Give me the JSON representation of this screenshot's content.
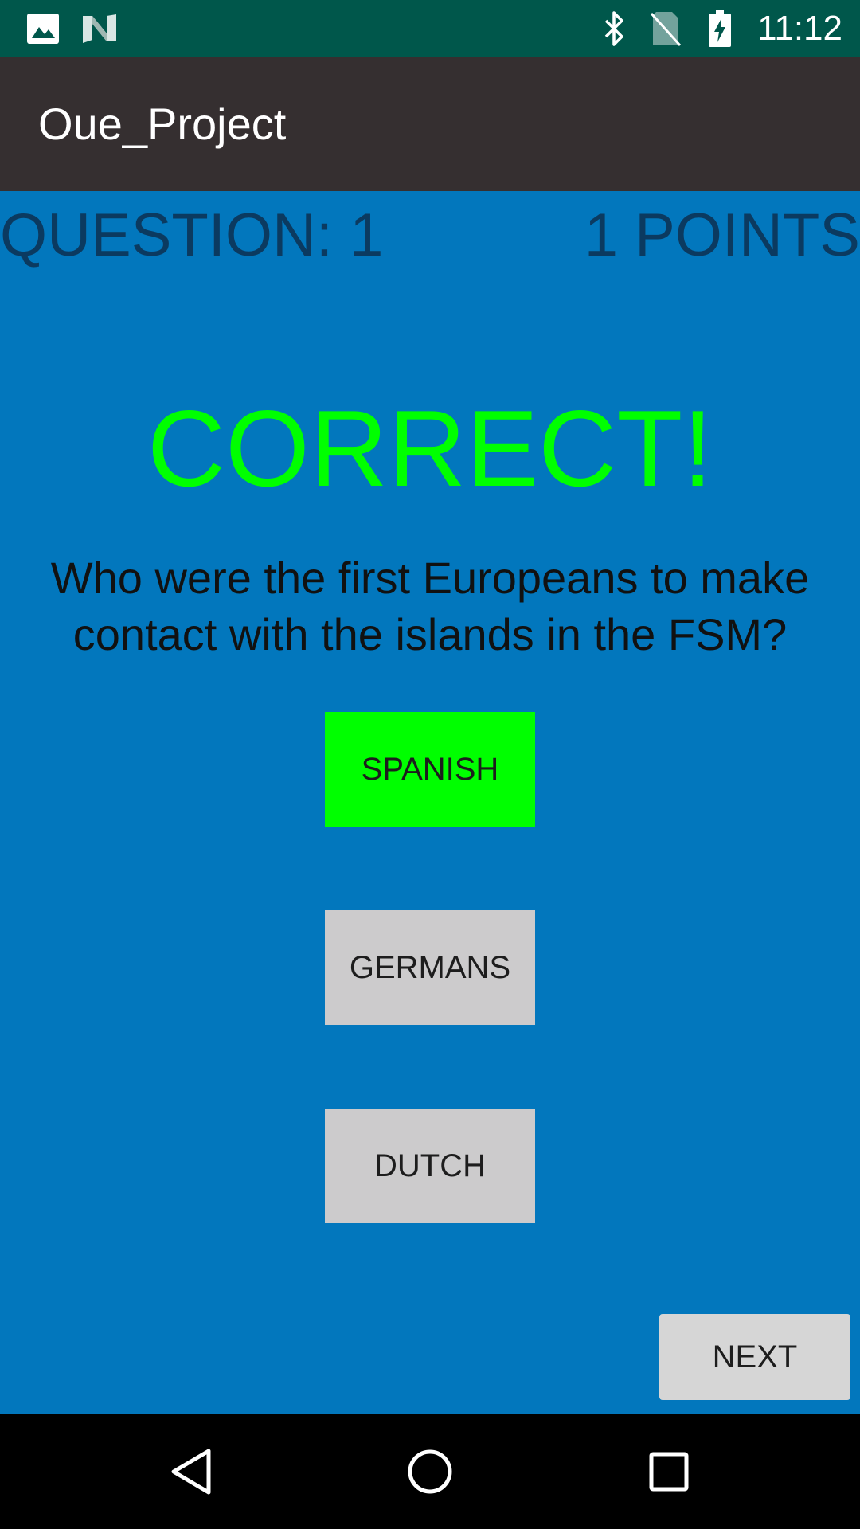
{
  "status_bar": {
    "time": "11:12",
    "icons": [
      "image-icon",
      "n-logo-icon",
      "bluetooth-icon",
      "no-sim-icon",
      "battery-charging-icon"
    ]
  },
  "app_bar": {
    "title": "Oue_Project"
  },
  "quiz": {
    "question_number": "QUESTION: 1",
    "points": "1 POINTS",
    "result": "CORRECT!",
    "question": "Who were the first Europeans to make contact with the islands in the FSM?",
    "answers": [
      {
        "label": "SPANISH",
        "state": "correct"
      },
      {
        "label": "GERMANS",
        "state": "default"
      },
      {
        "label": "DUTCH",
        "state": "default"
      }
    ],
    "next_label": "NEXT"
  },
  "colors": {
    "status_bar": "#00574b",
    "app_bar": "#352f30",
    "background": "#0277bd",
    "correct": "#00ff00",
    "button": "#cccbcc",
    "header_text": "#0b3a60"
  },
  "nav_bar": {
    "icons": [
      "back-icon",
      "home-icon",
      "recents-icon"
    ]
  }
}
